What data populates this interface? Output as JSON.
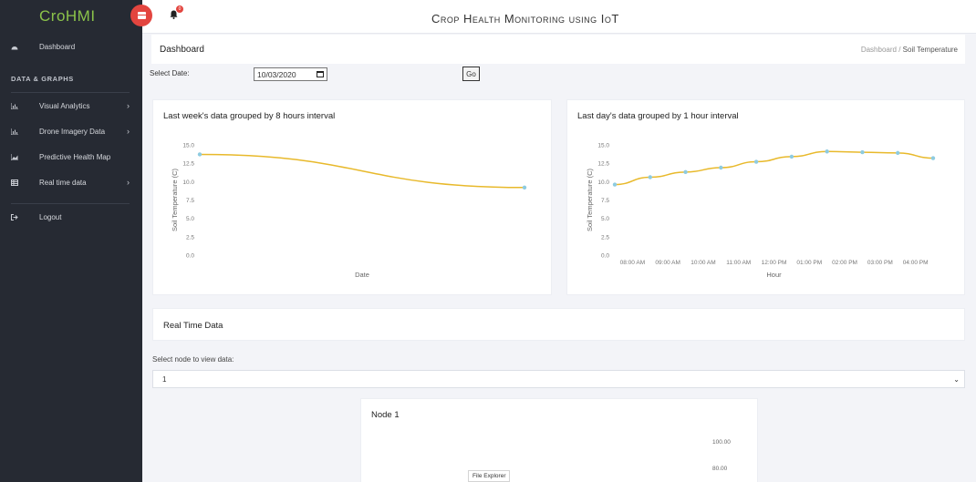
{
  "brand": "CroHMI",
  "app_title": "Crop Health Monitoring using IoT",
  "notifications": {
    "count": "0"
  },
  "sidebar": {
    "dashboard": "Dashboard",
    "section_heading": "DATA & GRAPHS",
    "items": [
      {
        "label": "Visual Analytics",
        "icon": "chart-icon",
        "expandable": true
      },
      {
        "label": "Drone Imagery Data",
        "icon": "chart-icon",
        "expandable": true
      },
      {
        "label": "Predictive Health Map",
        "icon": "area-chart-icon",
        "expandable": false
      },
      {
        "label": "Real time data",
        "icon": "table-icon",
        "expandable": true
      }
    ],
    "logout": "Logout"
  },
  "page": {
    "title": "Dashboard",
    "breadcrumb": [
      "Dashboard",
      "Soil Temperature"
    ],
    "breadcrumb_separator": "/"
  },
  "date_filter": {
    "label": "Select Date:",
    "value": "10/03/2020",
    "go_label": "Go"
  },
  "chart_data": [
    {
      "type": "line",
      "title": "Last week's data grouped by 8 hours interval",
      "xlabel": "Date",
      "ylabel": "Soil Temperature (C)",
      "ylim": [
        0,
        15
      ],
      "yticks": [
        "15.0",
        "12.5",
        "10.0",
        "7.5",
        "5.0",
        "2.5",
        "0.0"
      ],
      "x": [
        "",
        ""
      ],
      "values": [
        13.7,
        9.2
      ],
      "line_color": "#e8b92b",
      "point_color": "#8ecbe0"
    },
    {
      "type": "line",
      "title": "Last day's data grouped by 1 hour interval",
      "xlabel": "Hour",
      "ylabel": "Soil Temperature (C)",
      "ylim": [
        0,
        15
      ],
      "yticks": [
        "15.0",
        "12.5",
        "10.0",
        "7.5",
        "5.0",
        "2.5",
        "0.0"
      ],
      "x": [
        "08:00 AM",
        "09:00 AM",
        "10:00 AM",
        "11:00 AM",
        "12:00 PM",
        "01:00 PM",
        "02:00 PM",
        "03:00 PM",
        "04:00 PM"
      ],
      "values": [
        9.6,
        10.6,
        11.3,
        11.9,
        12.7,
        13.4,
        14.1,
        14.0,
        13.9,
        13.2
      ],
      "line_color": "#e8b92b",
      "point_color": "#8ecbe0"
    }
  ],
  "realtime": {
    "title": "Real Time Data",
    "select_label": "Select node to view data:",
    "selected_node": "1",
    "node_title": "Node 1",
    "node_yticks": [
      "100.00",
      "80.00"
    ],
    "tooltip": "File Explorer"
  }
}
